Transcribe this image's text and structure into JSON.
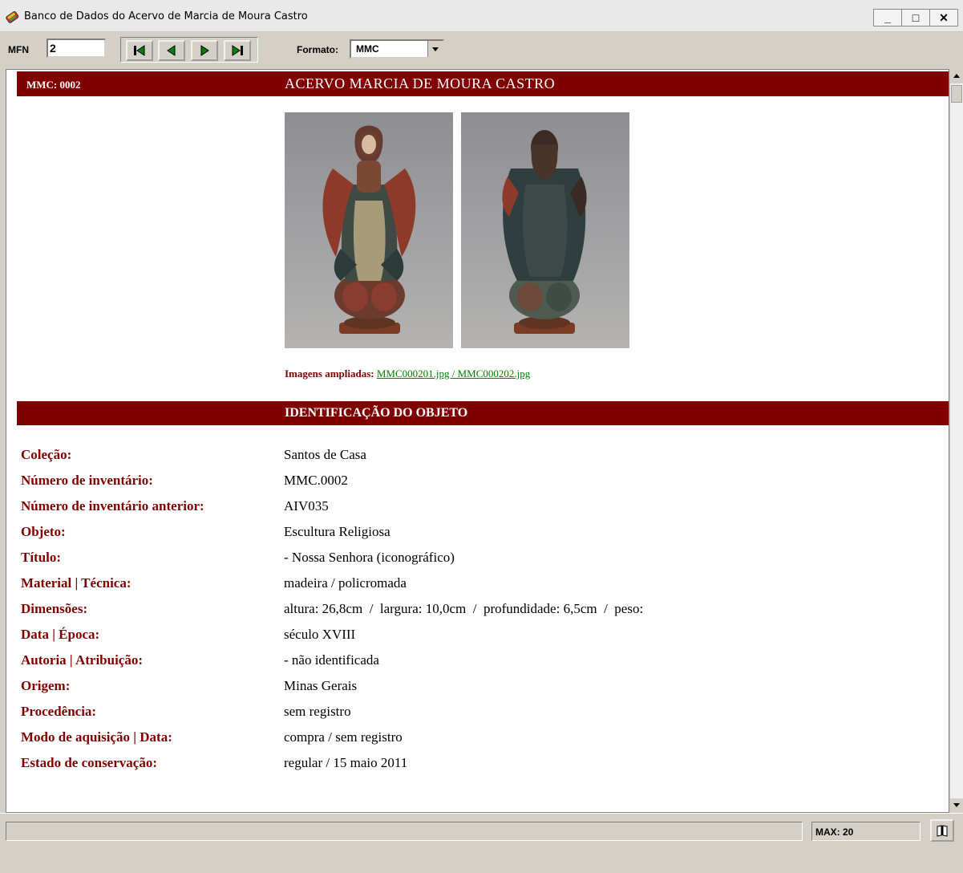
{
  "window": {
    "title": "Banco de Dados do Acervo de Marcia de Moura Castro",
    "minimize_label": "_",
    "maximize_label": "□",
    "close_label": "✕"
  },
  "toolbar": {
    "mfn_label": "MFN",
    "mfn_value": "2",
    "formato_label": "Formato:",
    "formato_value": "MMC",
    "nav_icons": [
      "first-record-icon",
      "previous-record-icon",
      "next-record-icon",
      "last-record-icon"
    ]
  },
  "record": {
    "id": "MMC: 0002",
    "header_title": "ACERVO MARCIA DE MOURA CASTRO",
    "images_label": "Imagens ampliadas:",
    "images_link": "MMC000201.jpg / MMC000202.jpg",
    "section_title": "IDENTIFICAÇÃO DO OBJETO",
    "fields": [
      {
        "label": "Coleção:",
        "value": "Santos de Casa"
      },
      {
        "label": "Número de inventário:",
        "value": "MMC.0002"
      },
      {
        "label": "Número de inventário anterior:",
        "value": "AIV035"
      },
      {
        "label": "Objeto:",
        "value": "Escultura Religiosa"
      },
      {
        "label": "Título:",
        "value": "- Nossa Senhora (iconográfico)"
      },
      {
        "label": "Material | Técnica:",
        "value": "madeira / policromada"
      },
      {
        "label": "Dimensões:",
        "value": "altura: 26,8cm  /  largura: 10,0cm  /  profundidade: 6,5cm  /  peso:"
      },
      {
        "label": "Data | Época:",
        "value": "século XVIII"
      },
      {
        "label": "Autoria | Atribuição:",
        "value": "- não identificada"
      },
      {
        "label": "Origem:",
        "value": "Minas Gerais"
      },
      {
        "label": "Procedência:",
        "value": "sem registro"
      },
      {
        "label": "Modo de aquisição | Data:",
        "value": "compra / sem registro"
      },
      {
        "label": "Estado de conservação:",
        "value": "regular / 15 maio 2011"
      }
    ]
  },
  "statusbar": {
    "status_text": "",
    "max_text": "MAX: 20"
  },
  "colors": {
    "band": "#800000",
    "label_text": "#800000",
    "link": "#008000"
  }
}
